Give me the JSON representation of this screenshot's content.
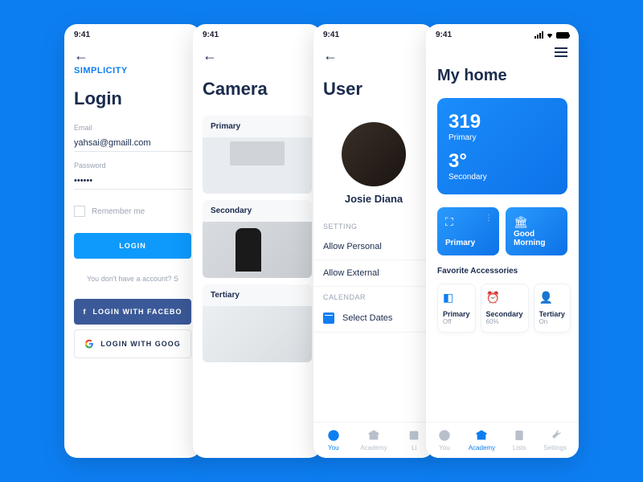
{
  "statusbar": {
    "time": "9:41"
  },
  "screen1": {
    "brand": "SIMPLICITY",
    "title": "Login",
    "email_label": "Email",
    "email_value": "yahsai@gmaill.com",
    "password_label": "Password",
    "password_value": "••••••",
    "remember": "Remember me",
    "login_btn": "LOGIN",
    "no_account": "You don't have a account? S",
    "fb_btn": "LOGIN WITH FACEBO",
    "google_btn": "LOGIN WITH GOOG"
  },
  "screen2": {
    "title": "Camera",
    "cards": [
      {
        "label": "Primary"
      },
      {
        "label": "Secondary"
      },
      {
        "label": "Tertiary"
      }
    ]
  },
  "screen3": {
    "title": "User",
    "username": "Josie Diana",
    "setting_label": "SETTING",
    "settings": [
      {
        "label": "Allow Personal"
      },
      {
        "label": "Allow External"
      }
    ],
    "calendar_label": "CALENDAR",
    "select_dates": "Select Dates",
    "nav": [
      {
        "label": "You"
      },
      {
        "label": "Academy"
      },
      {
        "label": "Li"
      }
    ]
  },
  "screen4": {
    "title": "My home",
    "hero": {
      "value1": "319",
      "label1": "Primary",
      "value2": "3°",
      "label2": "Secondary"
    },
    "tiles": [
      {
        "label": "Primary"
      },
      {
        "label": "Good Morning"
      }
    ],
    "favs_title": "Favorite Accessories",
    "favs": [
      {
        "name": "Primary",
        "status": "Off"
      },
      {
        "name": "Secondary",
        "status": "60%"
      },
      {
        "name": "Tertiary",
        "status": "On"
      }
    ],
    "nav": [
      {
        "label": "You"
      },
      {
        "label": "Academy"
      },
      {
        "label": "Lists"
      },
      {
        "label": "Settings"
      }
    ]
  }
}
